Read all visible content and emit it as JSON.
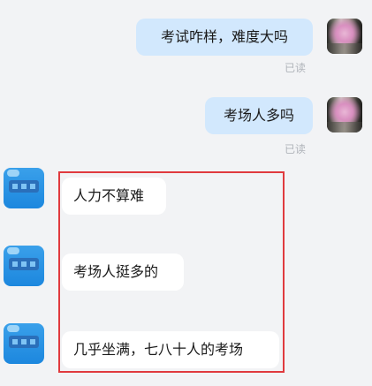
{
  "chat": {
    "messages": [
      {
        "sender": "me",
        "text": "考试咋样，难度大吗",
        "status": "已读"
      },
      {
        "sender": "me",
        "text": "考场人多吗",
        "status": "已读"
      },
      {
        "sender": "other",
        "text": "人力不算难"
      },
      {
        "sender": "other",
        "text": "考场人挺多的"
      },
      {
        "sender": "other",
        "text": "几乎坐满，七八十人的考场"
      }
    ]
  },
  "annotation": {
    "highlight_color": "#e03a3e"
  },
  "colors": {
    "background": "#f2f3f5",
    "outgoing_bubble": "#d2e8fd",
    "incoming_bubble": "#ffffff",
    "read_receipt": "#b0b4ba"
  }
}
